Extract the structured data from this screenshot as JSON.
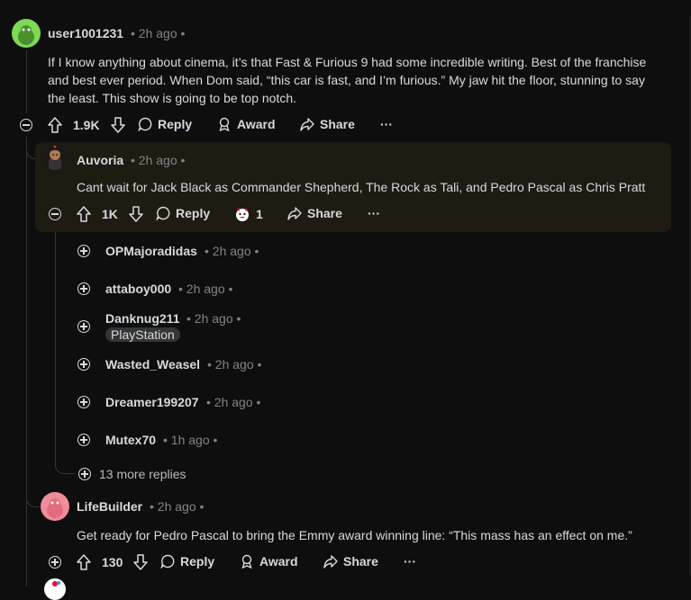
{
  "comments": {
    "top": {
      "username": "user1001231",
      "meta": "• 2h ago •",
      "body": "If I know anything about cinema, it’s that Fast & Furious 9 had some incredible writing. Best of the franchise and best ever period. When Dom said, “this car is fast, and I’m furious.” My jaw hit the floor, stunning to say the least. This show is going to be top notch.",
      "votes": "1.9K",
      "reply_label": "Reply",
      "award_label": "Award",
      "share_label": "Share",
      "more_label": "···"
    },
    "auvoria": {
      "username": "Auvoria",
      "meta": "• 2h ago •",
      "body": "Cant wait for Jack Black as Commander Shepherd, The Rock as Tali, and Pedro Pascal as Chris Pratt",
      "votes": "1K",
      "reply_label": "Reply",
      "award_count": "1",
      "share_label": "Share",
      "more_label": "···"
    },
    "collapsed": [
      {
        "username": "OPMajoradidas",
        "meta": "• 2h ago •"
      },
      {
        "username": "attaboy000",
        "meta": "• 2h ago •"
      },
      {
        "username": "Danknug211",
        "meta": "• 2h ago •",
        "flair": "PlayStation"
      },
      {
        "username": "Wasted_Weasel",
        "meta": "• 2h ago •"
      },
      {
        "username": "Dreamer199207",
        "meta": "• 2h ago •"
      },
      {
        "username": "Mutex70",
        "meta": "• 1h ago •"
      }
    ],
    "more_replies": "13 more replies",
    "lifebuilder": {
      "username": "LifeBuilder",
      "meta": "• 2h ago •",
      "body": "Get ready for Pedro Pascal to bring the Emmy award winning line: “This mass has an effect on me.”",
      "votes": "130",
      "reply_label": "Reply",
      "award_label": "Award",
      "share_label": "Share",
      "more_label": "···"
    }
  },
  "colors": {
    "background": "#0e0e0f",
    "highlight": "#1e1b13",
    "text": "#d7dadc",
    "muted": "#818384"
  }
}
